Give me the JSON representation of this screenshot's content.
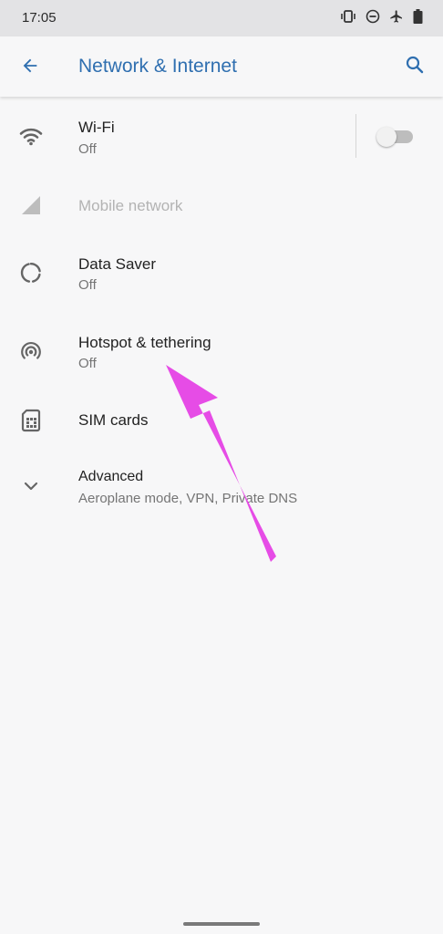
{
  "status_bar": {
    "time": "17:05",
    "icons": [
      "vibrate-icon",
      "do-not-disturb-icon",
      "airplane-icon",
      "battery-icon"
    ]
  },
  "app_bar": {
    "title": "Network & Internet",
    "back_icon": "arrow-back-icon",
    "search_icon": "search-icon"
  },
  "settings": [
    {
      "id": "wifi",
      "icon": "wifi-icon",
      "title": "Wi-Fi",
      "subtitle": "Off",
      "toggle": false,
      "enabled": true
    },
    {
      "id": "mobile",
      "icon": "mobile-signal-icon",
      "title": "Mobile network",
      "enabled": false
    },
    {
      "id": "data-saver",
      "icon": "data-saver-icon",
      "title": "Data Saver",
      "subtitle": "Off",
      "enabled": true
    },
    {
      "id": "hotspot",
      "icon": "hotspot-icon",
      "title": "Hotspot & tethering",
      "subtitle": "Off",
      "enabled": true
    },
    {
      "id": "sim",
      "icon": "sim-card-icon",
      "title": "SIM cards",
      "enabled": true
    },
    {
      "id": "advanced",
      "icon": "chevron-down-icon",
      "title": "Advanced",
      "subtitle": "Aeroplane mode, VPN, Private DNS",
      "enabled": true
    }
  ],
  "colors": {
    "accent": "#2f6fb0",
    "icon": "#666666",
    "annotation": "#e64ce6"
  }
}
